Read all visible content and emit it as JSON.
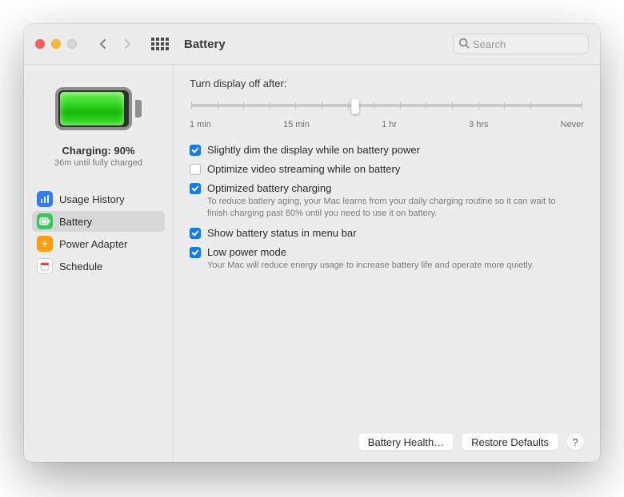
{
  "title": "Battery",
  "search": {
    "placeholder": "Search"
  },
  "sidebar": {
    "status_label": "Charging: 90%",
    "status_sub": "36m until fully charged",
    "items": [
      {
        "label": "Usage History"
      },
      {
        "label": "Battery"
      },
      {
        "label": "Power Adapter"
      },
      {
        "label": "Schedule"
      }
    ]
  },
  "main": {
    "slider_label": "Turn display off after:",
    "slider_value_pct": 42,
    "slider_ticks": [
      "1 min",
      "15 min",
      "1 hr",
      "3 hrs",
      "Never"
    ],
    "options": [
      {
        "checked": true,
        "label": "Slightly dim the display while on battery power"
      },
      {
        "checked": false,
        "label": "Optimize video streaming while on battery"
      },
      {
        "checked": true,
        "label": "Optimized battery charging",
        "desc": "To reduce battery aging, your Mac learns from your daily charging routine so it can wait to finish charging past 80% until you need to use it on battery."
      },
      {
        "checked": true,
        "label": "Show battery status in menu bar"
      },
      {
        "checked": true,
        "label": "Low power mode",
        "desc": "Your Mac will reduce energy usage to increase battery life and operate more quietly."
      }
    ]
  },
  "footer": {
    "battery_health": "Battery Health…",
    "restore_defaults": "Restore Defaults",
    "help": "?"
  }
}
